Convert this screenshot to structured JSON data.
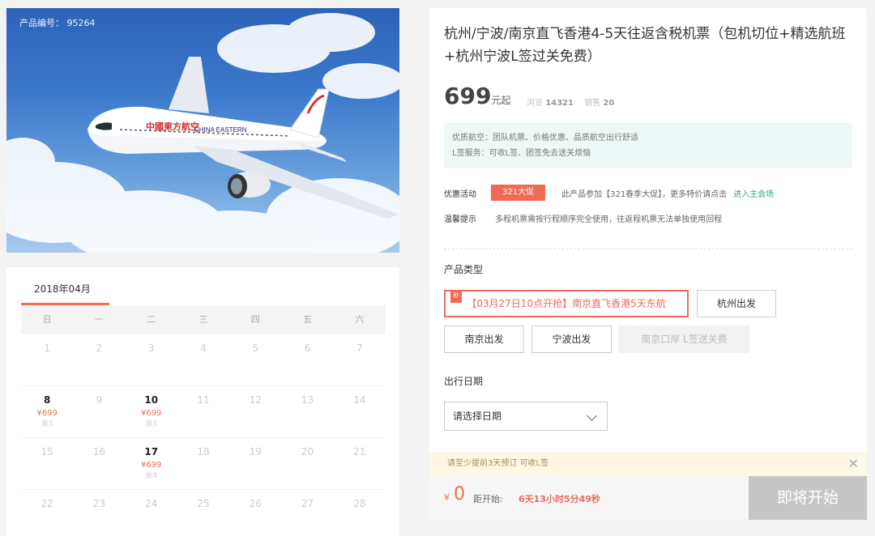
{
  "hero": {
    "product_id": "产品编号： 95264"
  },
  "calendar": {
    "month": "2018年04月",
    "weekdays": [
      "日",
      "一",
      "二",
      "三",
      "四",
      "五",
      "六"
    ],
    "weeks": [
      [
        {
          "d": "1"
        },
        {
          "d": "2"
        },
        {
          "d": "3"
        },
        {
          "d": "4"
        },
        {
          "d": "5"
        },
        {
          "d": "6"
        },
        {
          "d": "7"
        }
      ],
      [
        {
          "d": "8",
          "p": "¥699",
          "s": "余3",
          "a": true
        },
        {
          "d": "9"
        },
        {
          "d": "10",
          "p": "¥699",
          "s": "余3",
          "a": true
        },
        {
          "d": "11"
        },
        {
          "d": "12"
        },
        {
          "d": "13"
        },
        {
          "d": "14"
        }
      ],
      [
        {
          "d": "15"
        },
        {
          "d": "16"
        },
        {
          "d": "17",
          "p": "¥699",
          "s": "余4",
          "a": true
        },
        {
          "d": "18"
        },
        {
          "d": "19"
        },
        {
          "d": "20"
        },
        {
          "d": "21"
        }
      ],
      [
        {
          "d": "22"
        },
        {
          "d": "23"
        },
        {
          "d": "24"
        },
        {
          "d": "25"
        },
        {
          "d": "26"
        },
        {
          "d": "27"
        },
        {
          "d": "28"
        }
      ]
    ]
  },
  "product": {
    "title": "杭州/宁波/南京直飞香港4-5天往返含税机票（包机切位+精选航班+杭州宁波L签过关免费）",
    "price": "699",
    "price_unit": "元起",
    "views_label": "浏览",
    "views": "14321",
    "sales_label": "销售",
    "sales": "20",
    "notice_line1": "优质航空：团队机票、价格优惠、品质航空出行舒适",
    "notice_line2": "L签服务：可收L签、团签免去送关烦恼",
    "promo_label": "优惠活动",
    "promo_tag": "321大促",
    "promo_text": "此产品参加【321春季大促】，更多特价请点击",
    "promo_link": "进入主会场",
    "tip_label": "温馨提示",
    "tip_text": "多程机票需按行程顺序完全使用，往返程机票无法单独使用回程"
  },
  "types": {
    "label": "产品类型",
    "flag": "秒",
    "options": [
      "【03月27日10点开抢】南京直飞香港5天东航",
      "杭州出发",
      "南京出发",
      "宁波出发",
      "南京口岸 L签送关费"
    ]
  },
  "date": {
    "label": "出行日期",
    "placeholder": "请选择日期"
  },
  "hint": {
    "text": "请至少提前3天预订 可收L签",
    "close": "✕"
  },
  "footer": {
    "currency": "¥",
    "amount": "0",
    "start_label": "距开始:",
    "countdown": "6天13小时5分49秒",
    "button": "即将开始"
  }
}
